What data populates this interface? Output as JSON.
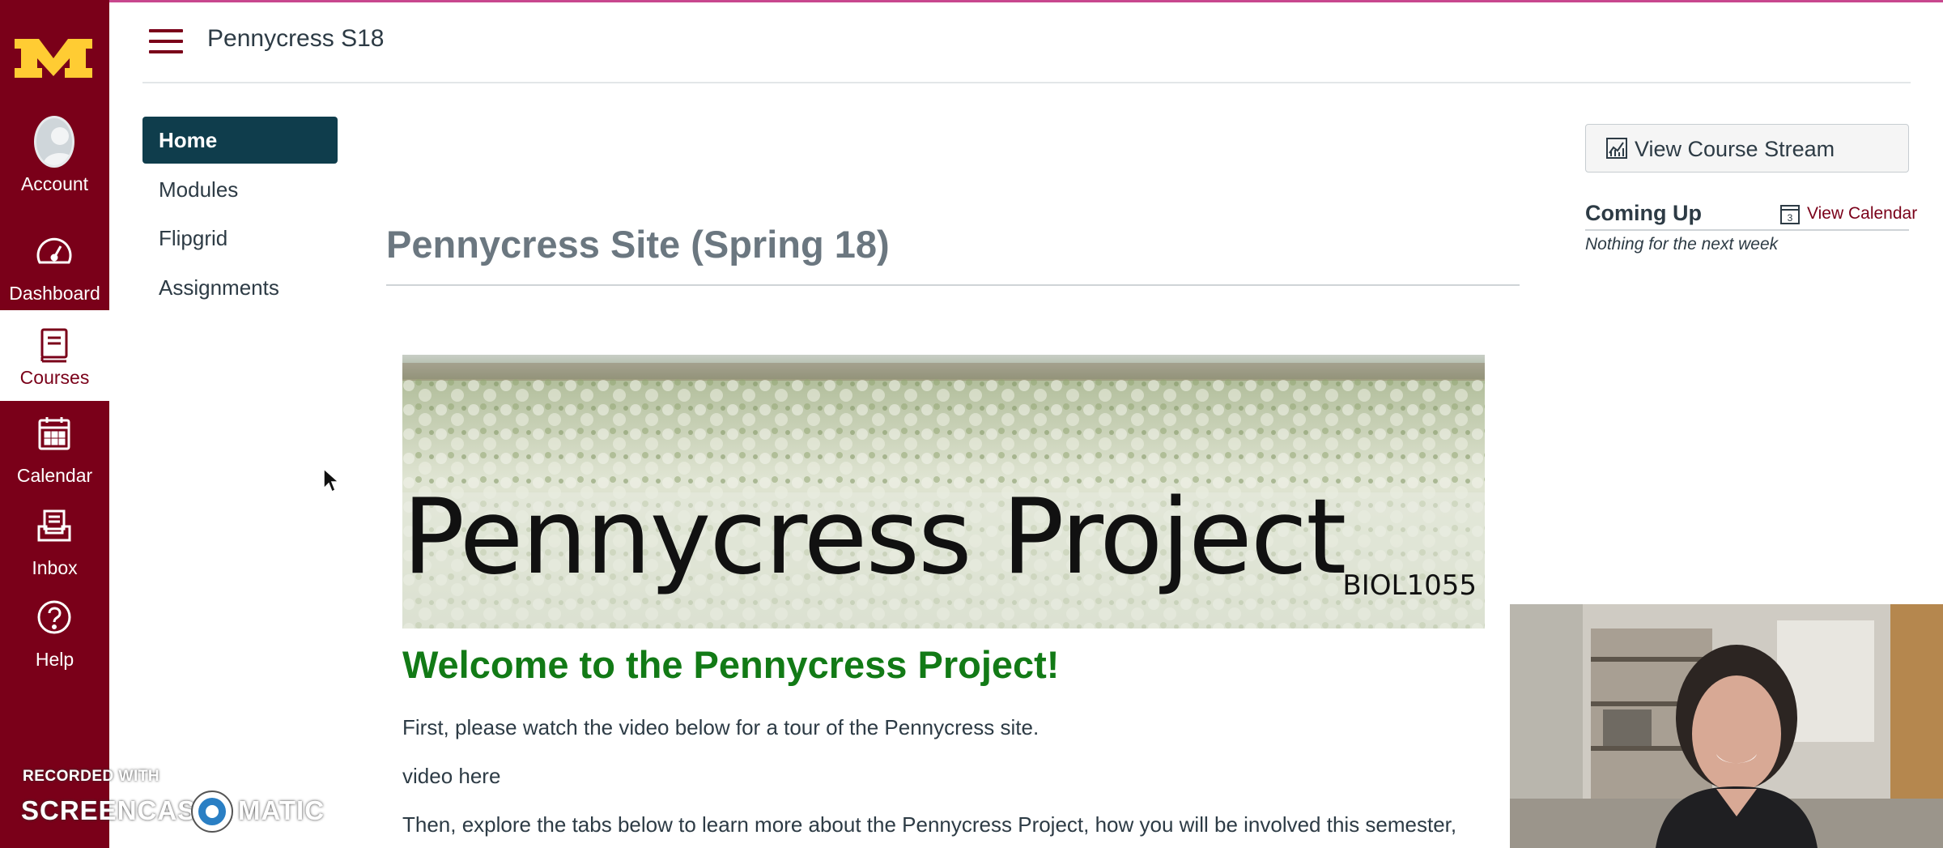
{
  "course_nav_header": {
    "title": "Pennycress S18"
  },
  "global_nav": {
    "items": [
      {
        "label": "Account",
        "icon": "account-avatar-icon"
      },
      {
        "label": "Dashboard",
        "icon": "speedometer-icon"
      },
      {
        "label": "Courses",
        "icon": "book-icon",
        "active": true
      },
      {
        "label": "Calendar",
        "icon": "calendar-icon"
      },
      {
        "label": "Inbox",
        "icon": "inbox-icon"
      },
      {
        "label": "Help",
        "icon": "question-circle-icon"
      }
    ],
    "brand_color": "#7a0019",
    "accent_gold": "#ffcc33"
  },
  "course_nav": {
    "items": [
      {
        "label": "Home",
        "active": true
      },
      {
        "label": "Modules"
      },
      {
        "label": "Flipgrid"
      },
      {
        "label": "Assignments"
      }
    ]
  },
  "main": {
    "page_title": "Pennycress Site (Spring 18)",
    "banner": {
      "title": "Pennycress Project",
      "code": "BIOL1055"
    },
    "welcome_heading": "Welcome to the Pennycress Project!",
    "paragraphs": [
      "First, please watch the video below for a tour of the Pennycress site.",
      "video here",
      "Then, explore the tabs below to learn more about the Pennycress Project, how you will be involved this semester,"
    ],
    "welcome_color": "#127a16"
  },
  "sidebar": {
    "stream_button_label": "View Course Stream",
    "coming_up_title": "Coming Up",
    "view_calendar_label": "View Calendar",
    "calendar_icon_day": "3",
    "empty_text": "Nothing for the next week"
  },
  "watermark": {
    "recorded_with": "RECORDED WITH",
    "brand_left": "SCREENCAST",
    "brand_right": "MATIC"
  }
}
